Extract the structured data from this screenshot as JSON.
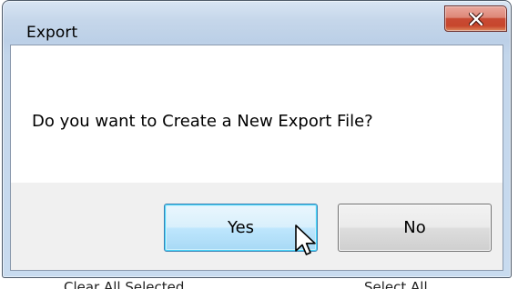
{
  "window": {
    "title": "Export"
  },
  "message": "Do you want to Create a New Export File?",
  "buttons": {
    "yes_label": "Yes",
    "no_label": "No"
  },
  "close_icon": "close-x-icon",
  "colors": {
    "close_button": "#c84a34",
    "frame": "#c5d6ea",
    "focused_button_border": "#3c7fb1"
  },
  "background_window": {
    "left_text": "Clear All Selected",
    "right_text": "Select All"
  }
}
